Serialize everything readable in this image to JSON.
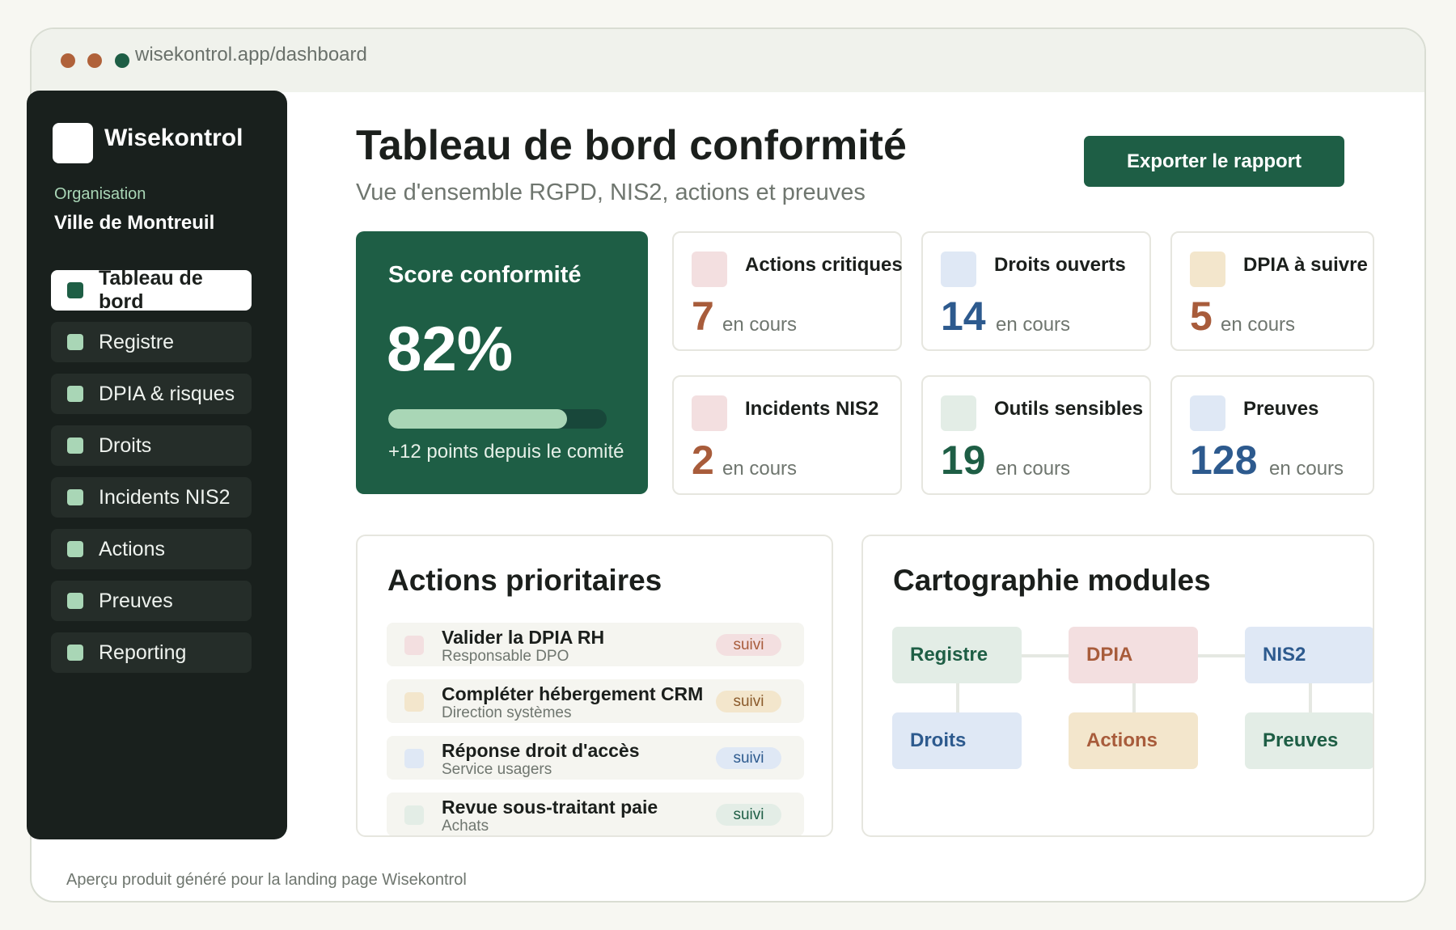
{
  "browser": {
    "url": "wisekontrol.app/dashboard"
  },
  "sidebar": {
    "brand": "Wisekontrol",
    "org_label": "Organisation",
    "org_name": "Ville de Montreuil",
    "items": [
      {
        "label": "Tableau de bord",
        "active": true
      },
      {
        "label": "Registre"
      },
      {
        "label": "DPIA & risques"
      },
      {
        "label": "Droits"
      },
      {
        "label": "Incidents NIS2"
      },
      {
        "label": "Actions"
      },
      {
        "label": "Preuves"
      },
      {
        "label": "Reporting"
      }
    ]
  },
  "header": {
    "title": "Tableau de bord conformité",
    "subtitle": "Vue d'ensemble RGPD, NIS2, actions et preuves",
    "export_label": "Exporter le rapport"
  },
  "score": {
    "label": "Score conformité",
    "value": "82%",
    "progress": 0.82,
    "note": "+12 points depuis le comité"
  },
  "stats": [
    {
      "title": "Actions critiques",
      "value": "7",
      "sub": "en cours",
      "icon_color": "#f3dfe0",
      "value_color": "#a85c3b"
    },
    {
      "title": "Droits ouverts",
      "value": "14",
      "sub": "en cours",
      "icon_color": "#dfe8f5",
      "value_color": "#2d5a8e"
    },
    {
      "title": "DPIA à suivre",
      "value": "5",
      "sub": "en cours",
      "icon_color": "#f3e6cc",
      "value_color": "#a85c3b"
    },
    {
      "title": "Incidents NIS2",
      "value": "2",
      "sub": "en cours",
      "icon_color": "#f3dfe0",
      "value_color": "#a85c3b"
    },
    {
      "title": "Outils sensibles",
      "value": "19",
      "sub": "en cours",
      "icon_color": "#e3ede6",
      "value_color": "#1e5e45"
    },
    {
      "title": "Preuves",
      "value": "128",
      "sub": "en cours",
      "icon_color": "#dfe8f5",
      "value_color": "#2d5a8e"
    }
  ],
  "actions_panel": {
    "title": "Actions prioritaires",
    "items": [
      {
        "title": "Valider la DPIA RH",
        "owner": "Responsable DPO",
        "badge": "suivi",
        "color": "#f3dfe0",
        "badge_text_color": "#a85c3b"
      },
      {
        "title": "Compléter hébergement CRM",
        "owner": "Direction systèmes",
        "badge": "suivi",
        "color": "#f3e6cc",
        "badge_text_color": "#8a5a2b"
      },
      {
        "title": "Réponse droit d'accès",
        "owner": "Service usagers",
        "badge": "suivi",
        "color": "#dfe8f5",
        "badge_text_color": "#2d5a8e"
      },
      {
        "title": "Revue sous-traitant paie",
        "owner": "Achats",
        "badge": "suivi",
        "color": "#e3ede6",
        "badge_text_color": "#1e5e45"
      }
    ]
  },
  "modules_panel": {
    "title": "Cartographie modules",
    "modules": [
      {
        "label": "Registre",
        "bg": "#e3ede6",
        "fg": "#1e5e45"
      },
      {
        "label": "DPIA",
        "bg": "#f3dfe0",
        "fg": "#a85c3b"
      },
      {
        "label": "NIS2",
        "bg": "#dfe8f5",
        "fg": "#2d5a8e"
      },
      {
        "label": "Droits",
        "bg": "#dfe8f5",
        "fg": "#2d5a8e"
      },
      {
        "label": "Actions",
        "bg": "#f3e6cc",
        "fg": "#a85c3b"
      },
      {
        "label": "Preuves",
        "bg": "#e3ede6",
        "fg": "#1e5e45"
      }
    ]
  },
  "footer": "Aperçu produit généré pour la landing page Wisekontrol"
}
